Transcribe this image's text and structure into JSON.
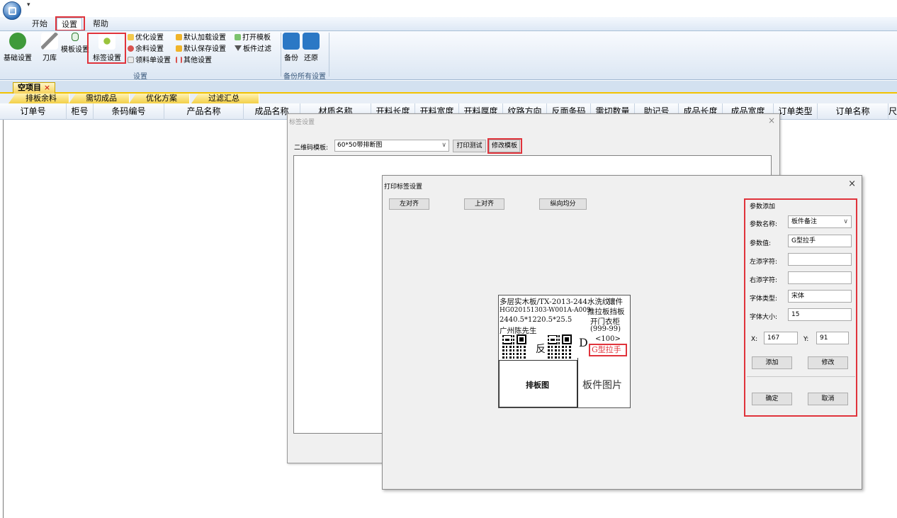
{
  "menu": {
    "tabs": [
      "开始",
      "设置",
      "帮助"
    ]
  },
  "ribbon": {
    "big_buttons": [
      "基础设置",
      "刀库",
      "模板设置",
      "标签设置"
    ],
    "small_col1": [
      "优化设置",
      "余料设置",
      "领料单设置"
    ],
    "small_col2": [
      "默认加载设置",
      "默认保存设置",
      "其他设置"
    ],
    "small_col3": [
      "打开模板",
      "板件过滤"
    ],
    "group1_label": "设置",
    "group2_buttons": [
      "备份",
      "还原"
    ],
    "group2_label": "备份所有设置"
  },
  "doc_tab": {
    "label": "空项目",
    "close": "×"
  },
  "sub_tabs": [
    "排板余料",
    "需切成品",
    "优化方案",
    "过滤汇总"
  ],
  "grid": {
    "columns": [
      "订单号",
      "柜号",
      "条码编号",
      "产品名称",
      "成品名称",
      "材质名称",
      "开料长度",
      "开料宽度",
      "开料厚度",
      "纹路方向",
      "反面条码",
      "需切数量",
      "助记号",
      "成品长度",
      "成品宽度",
      "订单类型",
      "订单名称",
      "尺"
    ]
  },
  "dialog_label": {
    "title": "标签设置",
    "template_label": "二维码模板:",
    "template_value": "60*50带排断图",
    "print_test": "打印测试",
    "modify_template": "修改模板",
    "close": "×"
  },
  "dialog_print": {
    "title": "打印标签设置",
    "close": "×",
    "btn_left_align": "左对齐",
    "btn_top_align": "上对齐",
    "btn_vertical_even": "纵向均分",
    "label_preview": {
      "line1": "多层实木板/TX-2013-244水洗纹",
      "line1_overlap": "镶件",
      "line2": "HG020151303-W001A-A009",
      "line2_right": "推拉板挡板",
      "line3": "2440.5*1220.5*25.5",
      "line3_right": "开门衣柜",
      "line4": "广州陈先生",
      "line4_right": "(999-99)",
      "reverse_char": "反",
      "d_char": "D",
      "count": "<100>",
      "handle": "G型拉手",
      "layout_box": "排板图",
      "part_image": "板件图片"
    },
    "panel": {
      "header": "参数添加",
      "name_label": "参数名称:",
      "name_value": "板件备注",
      "value_label": "参数值:",
      "value_value": "G型拉手",
      "left_label": "左添字符:",
      "left_value": "",
      "right_label": "右添字符:",
      "right_value": "",
      "font_type_label": "字体类型:",
      "font_type_value": "宋体",
      "font_size_label": "字体大小:",
      "font_size_value": "15",
      "x_label": "X:",
      "x_value": "167",
      "y_label": "Y:",
      "y_value": "91",
      "add_button": "添加",
      "modify_button": "修改",
      "ok_button": "确定",
      "cancel_button": "取消"
    }
  },
  "colors": {
    "highlight": "#e0333b",
    "ribbon_top": "#f9fbfe",
    "tab_yellow": "#f3cf47"
  }
}
